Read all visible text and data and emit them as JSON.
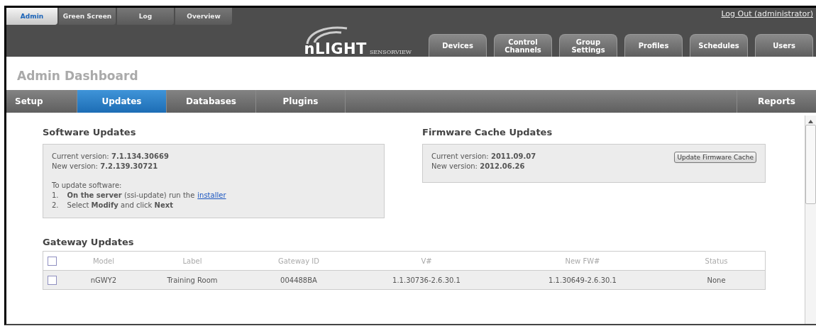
{
  "top_tabs": [
    {
      "label": "Admin",
      "selected": true
    },
    {
      "label": "Green Screen",
      "selected": false
    },
    {
      "label": "Log",
      "selected": false
    },
    {
      "label": "Overview",
      "selected": false
    }
  ],
  "logout": "Log Out (administrator)",
  "logo": {
    "brand": "nLIGHT",
    "product": "SENSORVIEW"
  },
  "main_tabs": [
    {
      "label": "Devices"
    },
    {
      "label": "Control Channels"
    },
    {
      "label": "Group Settings"
    },
    {
      "label": "Profiles"
    },
    {
      "label": "Schedules"
    },
    {
      "label": "Users"
    }
  ],
  "page_title": "Admin Dashboard",
  "nav": [
    {
      "label": "Setup",
      "selected": false,
      "kind": "left"
    },
    {
      "label": "Updates",
      "selected": true,
      "kind": "left"
    },
    {
      "label": "Databases",
      "selected": false,
      "kind": "left"
    },
    {
      "label": "Plugins",
      "selected": false,
      "kind": "left"
    },
    {
      "label": "Reports",
      "selected": false,
      "kind": "right"
    }
  ],
  "software": {
    "title": "Software Updates",
    "lines": [
      "Current version: **7.1.134.30669**",
      "New version: **7.2.139.30721**"
    ],
    "intro": "To update software:",
    "steps": [
      {
        "number": "1.",
        "text": "**On the server** (ssi-update) run the",
        "link": "installer"
      },
      {
        "number": "2.",
        "text": "Select **Modify** and click **Next**"
      }
    ]
  },
  "firmware": {
    "title": "Firmware Cache Updates",
    "lines": [
      "Current version: **2011.09.07**",
      "New version: **2012.06.26**"
    ],
    "button": "Update Firmware Cache"
  },
  "gateway": {
    "title": "Gateway Updates",
    "header_checked": false,
    "columns": [
      "Model",
      "Label",
      "Gateway ID",
      "V#",
      "New FW#",
      "Status"
    ],
    "rows": [
      {
        "checked": false,
        "cells": [
          "nGWY2",
          "Training Room",
          "004488BA",
          "1.1.30736-2.6.30.1",
          "1.1.30649-2.6.30.1",
          "None"
        ]
      }
    ]
  }
}
